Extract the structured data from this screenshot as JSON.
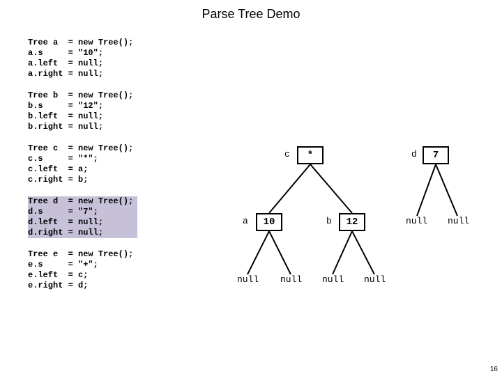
{
  "title": "Parse Tree Demo",
  "code": {
    "a": "Tree a  = new Tree();\na.s     = \"10\";\na.left  = null;\na.right = null;",
    "b": "Tree b  = new Tree();\nb.s     = \"12\";\nb.left  = null;\nb.right = null;",
    "c": "Tree c  = new Tree();\nc.s     = \"*\";\nc.left  = a;\nc.right = b;",
    "d": "Tree d  = new Tree();\nd.s     = \"7\";\nd.left  = null;\nd.right = null;",
    "e": "Tree e  = new Tree();\ne.s     = \"+\";\ne.left  = c;\ne.right = d;"
  },
  "tree": {
    "c_label": "c",
    "c_value": "*",
    "d_label": "d",
    "d_value": "7",
    "a_label": "a",
    "a_value": "10",
    "b_label": "b",
    "b_value": "12",
    "null": "null"
  },
  "page_number": "16"
}
